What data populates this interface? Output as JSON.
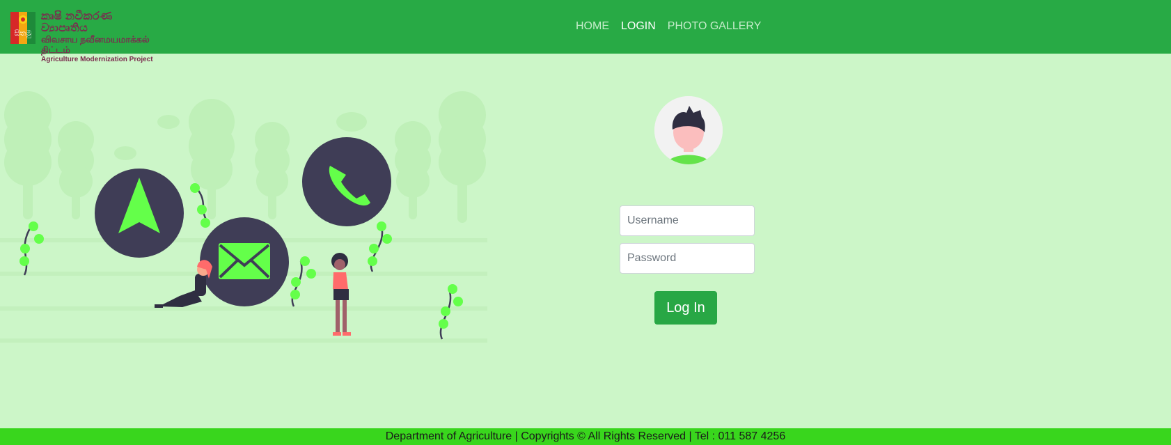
{
  "header": {
    "logo": {
      "mark_text": "සිතමු",
      "line1": "කෘෂි නවීකරණ ව්‍යාපෘතිය",
      "line2": "விவசாய நவீனமயமாக்கல் திட்டம்",
      "line3": "Agriculture Modernization Project"
    },
    "nav": [
      {
        "label": "HOME",
        "active": false
      },
      {
        "label": "LOGIN",
        "active": true
      },
      {
        "label": "PHOTO GALLERY",
        "active": false
      }
    ]
  },
  "illustration": {
    "icons": [
      "navigation-arrow-icon",
      "mail-icon",
      "phone-icon"
    ],
    "colors": {
      "bubble": "#3f3d56",
      "accent": "#64ff4a"
    }
  },
  "login": {
    "username_placeholder": "Username",
    "password_placeholder": "Password",
    "button_label": "Log In"
  },
  "footer": {
    "text": "Department of Agriculture | Copyrights © All Rights Reserved | Tel : 011 587 4256"
  },
  "colors": {
    "navbar": "#28aa45",
    "background": "#ccf6c8",
    "footer": "#39d61d",
    "button": "#28a745"
  }
}
